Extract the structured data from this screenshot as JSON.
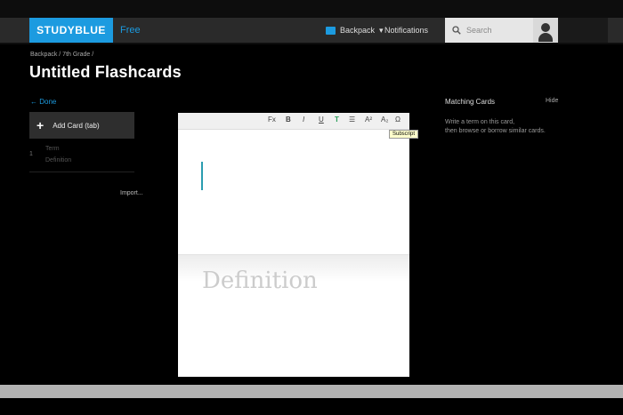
{
  "header": {
    "logo": "STUDYBLUE",
    "plan": "Free",
    "backpack_label": "Backpack",
    "backpack_caret": "▾",
    "notifications_label": "Notifications",
    "search_placeholder": "Search"
  },
  "breadcrumb": "Backpack / 7th Grade /",
  "page_title": "Untitled Flashcards",
  "sidebar": {
    "done_label": "← Done",
    "add_card_label": "Add Card (tab)",
    "card": {
      "number": "1",
      "term": "Term",
      "definition": "Definition"
    },
    "import_label": "Import..."
  },
  "editor": {
    "toolbar": [
      "Fx",
      "B",
      "I",
      "U",
      "T",
      "☰",
      "A²",
      "A₂",
      "Ω"
    ],
    "tooltip": "Subscript",
    "definition_placeholder": "Definition"
  },
  "matching": {
    "title": "Matching Cards",
    "hide_label": "Hide",
    "desc_line1": "Write a term on this card,",
    "desc_line2": "then browse or borrow similar cards."
  },
  "colors": {
    "accent": "#1c9be0",
    "background": "#000000"
  }
}
